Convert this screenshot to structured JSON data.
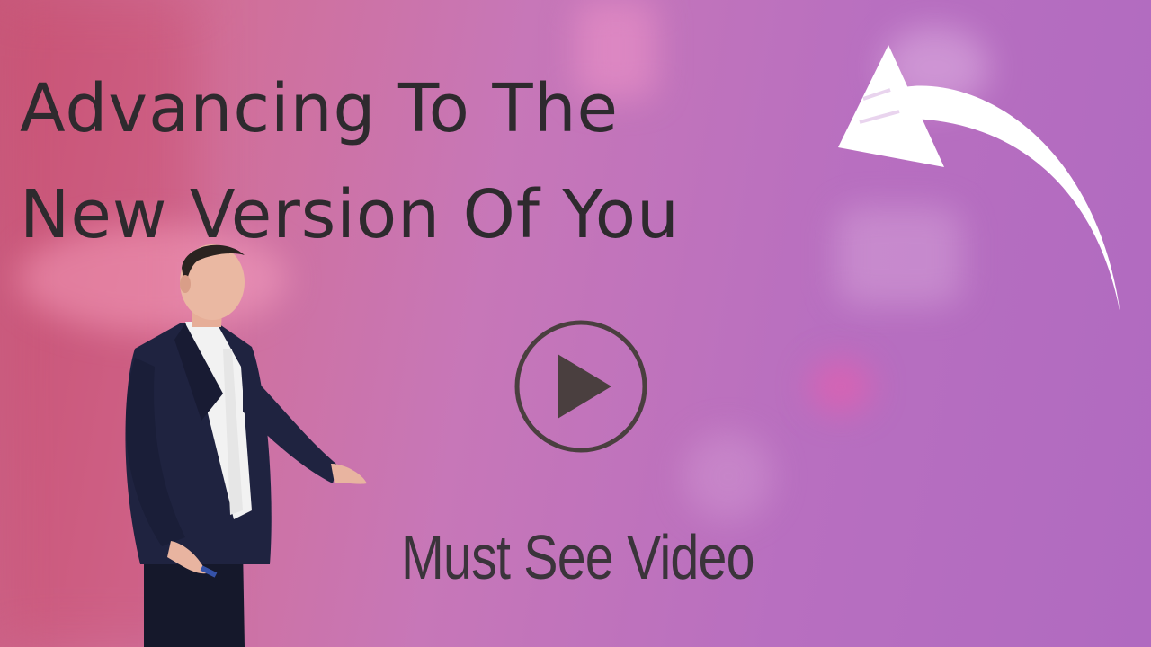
{
  "headline": {
    "line1": "Advancing To The",
    "line2": "New Version Of You"
  },
  "subtitle": "Must See Video",
  "icons": {
    "play": "play-icon",
    "arrow": "curved-arrow-icon"
  },
  "colors": {
    "text": "#2e2a2e",
    "arrow": "#ffffff",
    "play": "#4a3f3f",
    "suit": "#1f2340",
    "background_left": "#c85a7c",
    "background_right": "#b06ac0"
  }
}
